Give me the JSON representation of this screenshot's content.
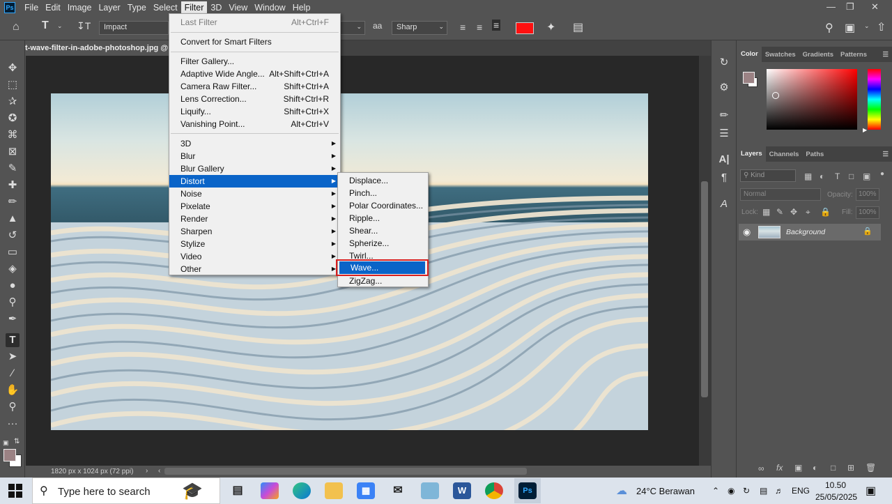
{
  "app": {
    "logo": "Ps"
  },
  "menubar": {
    "items": [
      "File",
      "Edit",
      "Image",
      "Layer",
      "Type",
      "Select",
      "Filter",
      "3D",
      "View",
      "Window",
      "Help"
    ],
    "active": "Filter",
    "window_controls": [
      "—",
      "❐",
      "✕"
    ]
  },
  "options": {
    "font_family": "Impact",
    "antialias": "Sharp",
    "text_color": "#ff1010"
  },
  "document": {
    "tab_title": "t-wave-filter-in-adobe-photoshop.jpg @ 5",
    "status": "1820 px x 1024 px (72 ppi)"
  },
  "filter_menu": {
    "items": [
      {
        "label": "Last Filter",
        "shortcut": "Alt+Ctrl+F",
        "disabled": true
      },
      {
        "label": "Convert for Smart Filters",
        "shortcut": ""
      },
      {
        "label": "Filter Gallery...",
        "shortcut": ""
      },
      {
        "label": "Adaptive Wide Angle...",
        "shortcut": "Alt+Shift+Ctrl+A"
      },
      {
        "label": "Camera Raw Filter...",
        "shortcut": "Shift+Ctrl+A"
      },
      {
        "label": "Lens Correction...",
        "shortcut": "Shift+Ctrl+R"
      },
      {
        "label": "Liquify...",
        "shortcut": "Shift+Ctrl+X"
      },
      {
        "label": "Vanishing Point...",
        "shortcut": "Alt+Ctrl+V"
      },
      {
        "label": "3D",
        "submenu": true
      },
      {
        "label": "Blur",
        "submenu": true
      },
      {
        "label": "Blur Gallery",
        "submenu": true
      },
      {
        "label": "Distort",
        "submenu": true,
        "highlighted": true
      },
      {
        "label": "Noise",
        "submenu": true
      },
      {
        "label": "Pixelate",
        "submenu": true
      },
      {
        "label": "Render",
        "submenu": true
      },
      {
        "label": "Sharpen",
        "submenu": true
      },
      {
        "label": "Stylize",
        "submenu": true
      },
      {
        "label": "Video",
        "submenu": true
      },
      {
        "label": "Other",
        "submenu": true
      }
    ]
  },
  "distort_menu": {
    "items": [
      "Displace...",
      "Pinch...",
      "Polar Coordinates...",
      "Ripple...",
      "Shear...",
      "Spherize...",
      "Twirl...",
      "Wave...",
      "ZigZag..."
    ],
    "highlighted": "Wave..."
  },
  "color_panel": {
    "tabs": [
      "Color",
      "Swatches",
      "Gradients",
      "Patterns"
    ],
    "active_tab": "Color",
    "foreground": "#9b8284",
    "background": "#ffffff"
  },
  "layers_panel": {
    "tabs": [
      "Layers",
      "Channels",
      "Paths"
    ],
    "active_tab": "Layers",
    "filter_placeholder": "Kind",
    "blend_mode": "Normal",
    "opacity_label": "Opacity:",
    "opacity_value": "100%",
    "lock_label": "Lock:",
    "fill_label": "Fill:",
    "fill_value": "100%",
    "layers": [
      {
        "name": "Background",
        "locked": true,
        "visible": true
      }
    ]
  },
  "taskbar": {
    "search_placeholder": "Type here to search",
    "weather": "24°C  Berawan",
    "language": "ENG",
    "time": "10.50",
    "date": "25/05/2025",
    "apps": [
      "task-view",
      "copilot",
      "edge",
      "file-explorer",
      "store",
      "mail",
      "notepad",
      "word",
      "chrome",
      "photoshop"
    ]
  }
}
